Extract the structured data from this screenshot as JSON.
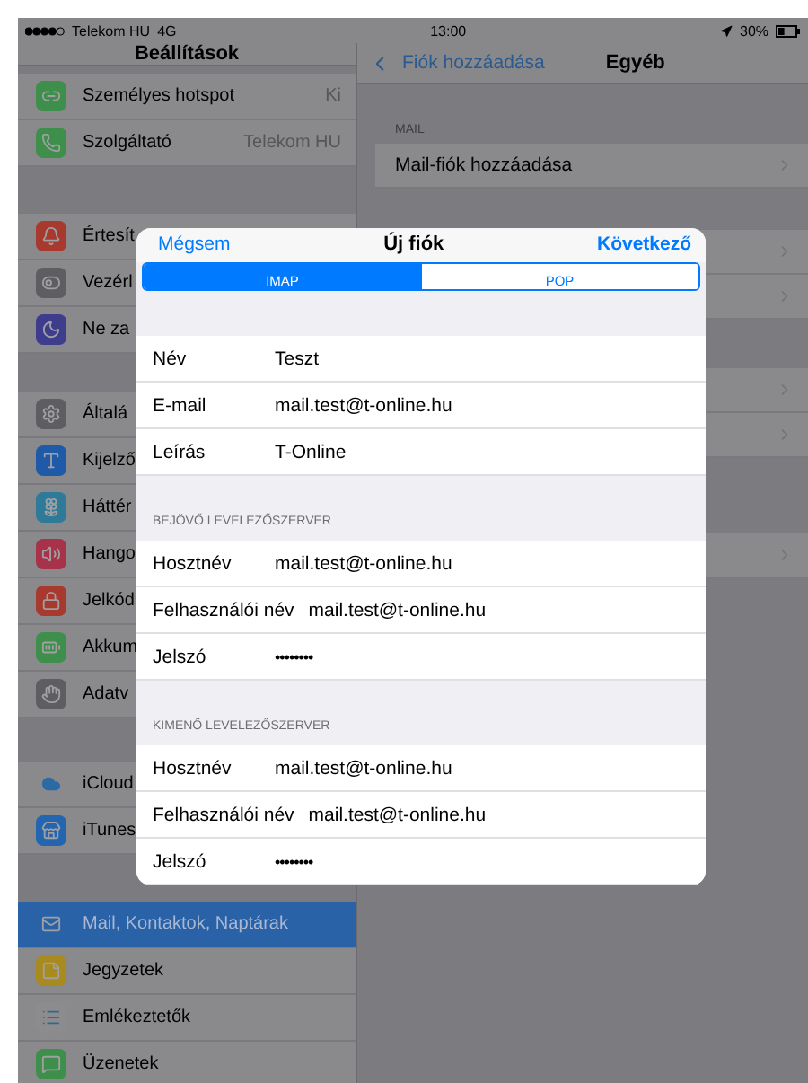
{
  "status_bar": {
    "carrier": "Telekom HU",
    "network": "4G",
    "time": "13:00",
    "battery": "30%"
  },
  "sidebar": {
    "title": "Beállítások",
    "groups": [
      [
        {
          "label": "Személyes hotspot",
          "value": "Ki",
          "color": "#3f8f4c",
          "selected": false
        },
        {
          "label": "Szolgáltató",
          "value": "Telekom HU",
          "color": "#3f8f4c",
          "selected": false
        }
      ],
      [
        {
          "label": "Értesít",
          "color": "#a8392f",
          "selected": false
        },
        {
          "label": "Vezérl",
          "color": "#5e5e62",
          "selected": false
        },
        {
          "label": "Ne za",
          "color": "#3e3c8c",
          "selected": false
        }
      ],
      [
        {
          "label": "Általá",
          "color": "#5e5e62",
          "selected": false
        },
        {
          "label": "Kijelző",
          "color": "#1f5aa8",
          "selected": false
        },
        {
          "label": "Háttér",
          "color": "#2f7a99",
          "selected": false
        },
        {
          "label": "Hango",
          "color": "#a8324a",
          "selected": false
        },
        {
          "label": "Jelkód",
          "color": "#a8392f",
          "selected": false
        },
        {
          "label": "Akkum",
          "color": "#3f8f4c",
          "selected": false
        },
        {
          "label": "Adatv",
          "color": "#5e5e62",
          "selected": false
        }
      ],
      [
        {
          "label": "iCloud",
          "color": "#2c6aa6",
          "selected": false
        },
        {
          "label": "iTunes",
          "color": "#2465b0",
          "selected": false
        }
      ],
      [
        {
          "label": "Mail, Kontaktok, Naptárak",
          "color": "#2a62a8",
          "selected": true
        },
        {
          "label": "Jegyzetek",
          "color": "#a88a1e",
          "selected": false
        },
        {
          "label": "Emlékeztetők",
          "color": "#8c8c8f",
          "selected": false
        },
        {
          "label": "Üzenetek",
          "color": "#3f8f4c",
          "selected": false
        }
      ]
    ]
  },
  "detail": {
    "back": "Fiók hozzáadása",
    "title": "Egyéb",
    "section_header": "MAIL",
    "row": "Mail-fiók hozzáadása"
  },
  "modal": {
    "cancel": "Mégsem",
    "title": "Új fiók",
    "next": "Következő",
    "segments": [
      {
        "label": "IMAP",
        "selected": true
      },
      {
        "label": "POP",
        "selected": false
      }
    ],
    "sections": [
      {
        "fields": [
          {
            "label": "Név",
            "value": "Teszt",
            "kind": "text"
          },
          {
            "label": "E-mail",
            "value": "mail.test@t-online.hu",
            "kind": "text"
          },
          {
            "label": "Leírás",
            "value": "T-Online",
            "kind": "text"
          }
        ]
      },
      {
        "header": "BEJÖVŐ LEVELEZŐSZERVER",
        "fields": [
          {
            "label": "Hosztnév",
            "value": "mail.test@t-online.hu",
            "kind": "text"
          },
          {
            "label": "Felhasználói név",
            "value": "mail.test@t-online.hu",
            "kind": "text"
          },
          {
            "label": "Jelszó",
            "value": "••••••••",
            "kind": "password"
          }
        ]
      },
      {
        "header": "KIMENŐ LEVELEZŐSZERVER",
        "fields": [
          {
            "label": "Hosztnév",
            "value": "mail.test@t-online.hu",
            "kind": "text"
          },
          {
            "label": "Felhasználói név",
            "value": "mail.test@t-online.hu",
            "kind": "text"
          },
          {
            "label": "Jelszó",
            "value": "••••••••",
            "kind": "password"
          }
        ]
      }
    ]
  }
}
